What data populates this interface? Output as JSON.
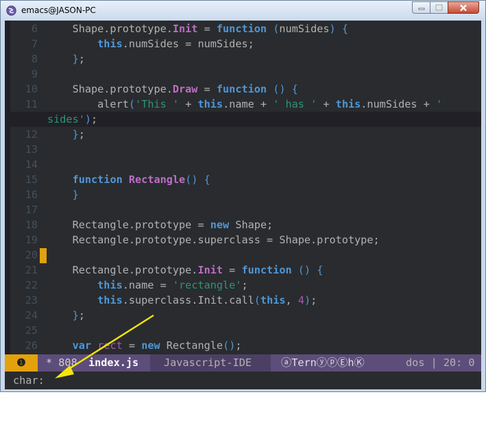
{
  "window": {
    "title": "emacs@JASON-PC"
  },
  "editor": {
    "lines": [
      {
        "num": "6",
        "code": "    Shape.prototype.<f>Init</f> = <k>function</k> <p>(</p>numSides<p>)</p> <p>{</p>"
      },
      {
        "num": "7",
        "code": "        <k>this</k>.numSides = numSides;"
      },
      {
        "num": "8",
        "code": "    <p>}</p>;"
      },
      {
        "num": "9",
        "code": ""
      },
      {
        "num": "10",
        "code": "    Shape.prototype.<f>Draw</f> = <k>function</k> <p>()</p> <p>{</p>"
      },
      {
        "num": "11",
        "code": "        alert<p>(</p><s>'This '</s> + <k>this</k>.name + <s>' has '</s> + <k>this</k>.numSides + <s>'</s>"
      },
      {
        "num": "",
        "code": "<s>sides'</s><p>)</p>;",
        "wrap": true,
        "hl": true
      },
      {
        "num": "12",
        "code": "    <p>}</p>;"
      },
      {
        "num": "13",
        "code": ""
      },
      {
        "num": "14",
        "code": ""
      },
      {
        "num": "15",
        "code": "    <k>function</k> <f>Rectangle</f><p>()</p> <p>{</p>"
      },
      {
        "num": "16",
        "code": "    <p>}</p>"
      },
      {
        "num": "17",
        "code": ""
      },
      {
        "num": "18",
        "code": "    Rectangle.prototype = <k>new</k> Shape;"
      },
      {
        "num": "19",
        "code": "    Rectangle.prototype.superclass = Shape.prototype;"
      },
      {
        "num": "20",
        "code": ""
      },
      {
        "num": "21",
        "code": "    Rectangle.prototype.<f>Init</f> = <k>function</k> <p>()</p> <p>{</p>"
      },
      {
        "num": "22",
        "code": "        <k>this</k>.name = <s>'rectangle'</s>;"
      },
      {
        "num": "23",
        "code": "        <k>this</k>.superclass.Init.call<p>(</p><k>this</k>, <c>4</c><p>)</p>;"
      },
      {
        "num": "24",
        "code": "    <p>}</p>;"
      },
      {
        "num": "25",
        "code": ""
      },
      {
        "num": "26",
        "code": "    <k>var</k> <c>rect</c> = <k>new</k> Rectangle<p>()</p>;"
      }
    ]
  },
  "modeline": {
    "window_number": "❶",
    "modified": "* 808",
    "buffer_name": "index.js",
    "major_mode": "Javascript-IDE",
    "minor_modes": "ⓐTernⓨⓟⒺhⓀ",
    "encoding_position": "dos | 20: 0"
  },
  "minibuffer": {
    "prompt": "char:"
  },
  "colors": {
    "background": "#292b2e",
    "keyword": "#4f97d7",
    "function_name": "#bc6ec5",
    "string": "#2d9574",
    "modeline": "#5d4d7a",
    "window_number_badge": "#e3a10e",
    "cursor": "#e3a10e",
    "annotation_arrow": "#f5e50a"
  }
}
